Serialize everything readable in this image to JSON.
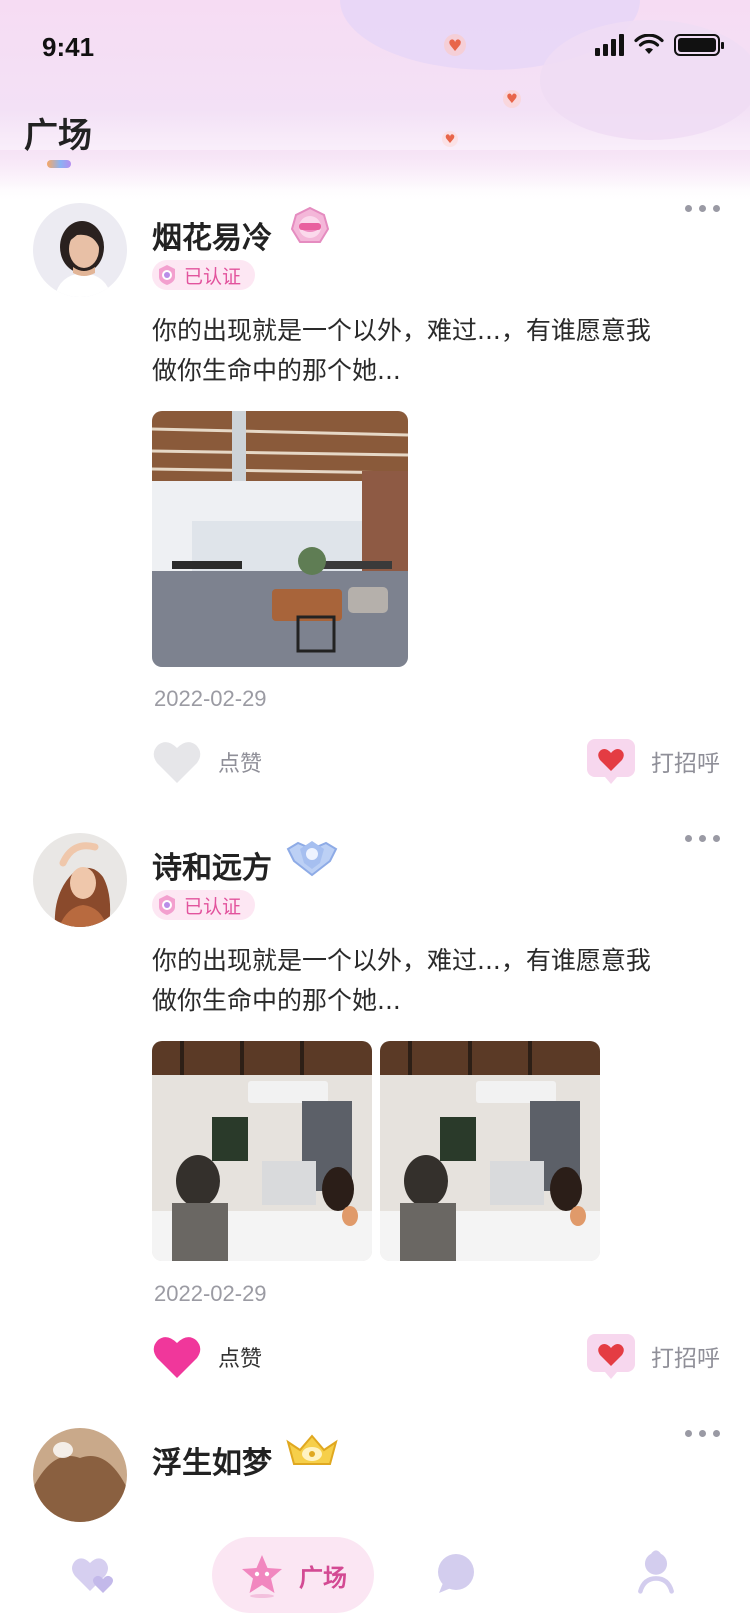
{
  "status_bar": {
    "time": "9:41"
  },
  "header": {
    "title": "广场"
  },
  "posts": [
    {
      "username": "烟花易冷",
      "badge_icon": "lotus-level-badge",
      "verified_label": "已认证",
      "text_line1": "你的出现就是一个以外，难过...，有谁愿意我",
      "text_line2": "做你生命中的那个她...",
      "date": "2022-02-29",
      "like_label": "点赞",
      "liked": false,
      "greet_label": "打招呼"
    },
    {
      "username": "诗和远方",
      "badge_icon": "diamond-level-badge",
      "verified_label": "已认证",
      "text_line1": "你的出现就是一个以外，难过...，有谁愿意我",
      "text_line2": "做你生命中的那个她...",
      "date": "2022-02-29",
      "like_label": "点赞",
      "liked": true,
      "greet_label": "打招呼"
    },
    {
      "username": "浮生如梦",
      "badge_icon": "crown-level-badge"
    }
  ],
  "tabbar": {
    "items": [
      {
        "icon": "heart-match-icon",
        "label": ""
      },
      {
        "icon": "star-plaza-icon",
        "label": "广场",
        "active": true
      },
      {
        "icon": "chat-bubble-icon",
        "label": ""
      },
      {
        "icon": "profile-icon",
        "label": ""
      }
    ]
  },
  "colors": {
    "accent_pink": "#f0379b",
    "verified_bg": "#fde7f3",
    "verified_text": "#e2539d",
    "tab_active_bg": "#fbe6f3",
    "tab_inactive": "#cfc8ea"
  }
}
